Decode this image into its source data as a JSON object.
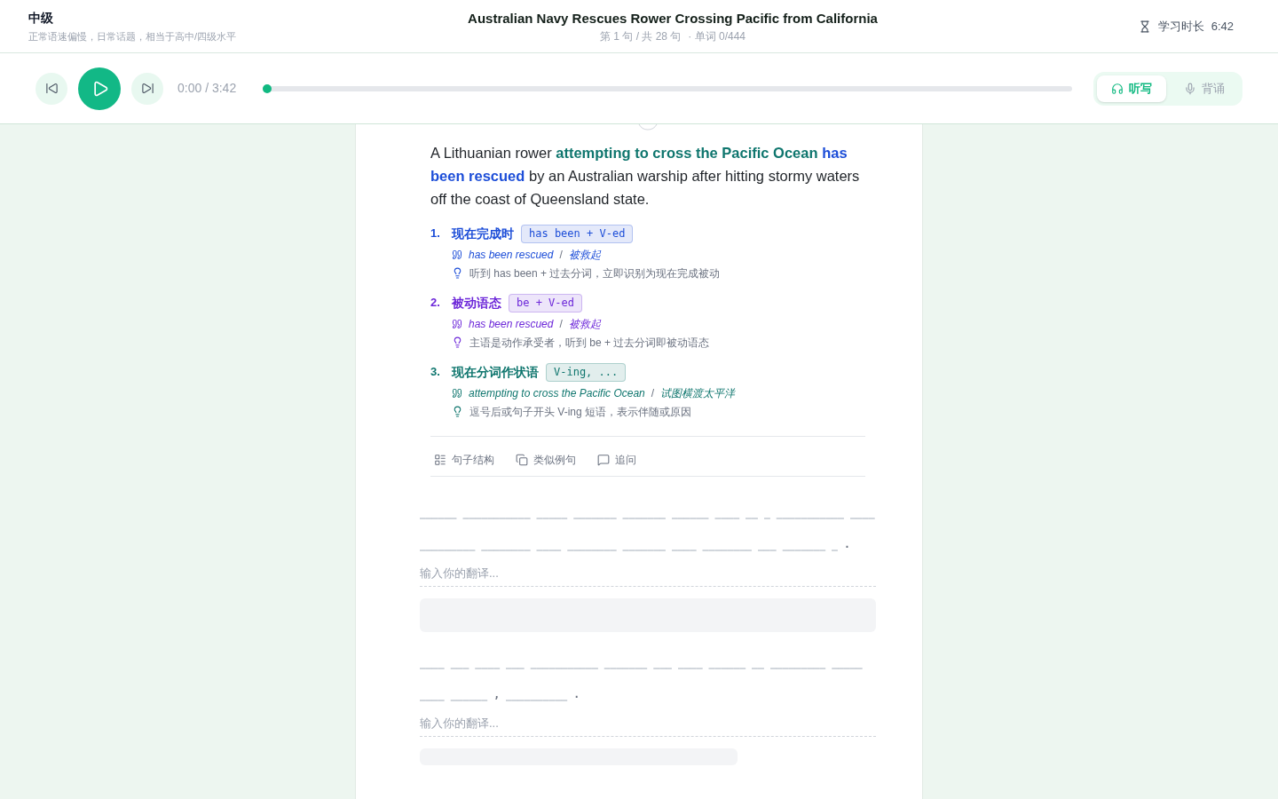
{
  "header": {
    "difficulty": "中级",
    "difficulty_description": "正常语速偏慢，日常话题，相当于高中/四级水平",
    "title": "Australian Navy Rescues Rower Crossing Pacific from California",
    "sentence_counter": "第 1 句 / 共 28 句",
    "word_count": "· 单词 0/444",
    "study_time_label": "学习时长",
    "study_time": "6:42"
  },
  "player": {
    "time": "0:00 / 3:42",
    "progress": {
      "level": 0
    },
    "modes": [
      {
        "label": "听写",
        "kind": "dictation",
        "selected": true
      },
      {
        "label": "背诵",
        "kind": "recite",
        "selected": false
      }
    ]
  },
  "sentence": {
    "segments": [
      {
        "text": "A Lithuanian rower"
      },
      {
        "text": "attempting to cross the Pacific Ocean",
        "color": "#0f766e"
      },
      {
        "text": "has been rescued",
        "color": "#1d4ed8"
      },
      {
        "text": "by an Australian warship after hitting stormy waters off the coast of Queensland state."
      }
    ]
  },
  "grammar_points": [
    {
      "number": "1.",
      "title": "现在完成时",
      "pattern": "has been + V-ed",
      "example": "has been rescued",
      "separator": "/",
      "translation": "被救起",
      "tip": "听到 has been + 过去分词，立即识别为现在完成被动",
      "color": "#1d4ed8"
    },
    {
      "number": "2.",
      "title": "被动语态",
      "pattern": "be + V-ed",
      "example": "has been rescued",
      "separator": "/",
      "translation": "被救起",
      "tip": "主语是动作承受者，听到 be + 过去分词即被动语态",
      "color": "#6d28d9"
    },
    {
      "number": "3.",
      "title": "现在分词作状语",
      "pattern": "V-ing, ...",
      "example": "attempting to cross the Pacific Ocean",
      "separator": "/",
      "translation": "试图横渡太平洋",
      "tip": "逗号后或句子开头 V-ing 短语，表示伴随或原因",
      "color": "#0f766e"
    }
  ],
  "actions": [
    {
      "label": "句子结构",
      "kind": "structure"
    },
    {
      "label": "类似例句",
      "kind": "examples"
    },
    {
      "label": "追问",
      "kind": "ask"
    }
  ],
  "dictation": [
    {
      "tokens": [
        {
          "kind": "blank",
          "text": "______"
        },
        {
          "kind": "blank",
          "text": "___________"
        },
        {
          "kind": "blank",
          "text": "_____"
        },
        {
          "kind": "blank",
          "text": "_______"
        },
        {
          "kind": "blank",
          "text": "_______"
        },
        {
          "kind": "blank",
          "text": "______"
        },
        {
          "kind": "blank",
          "text": "____"
        },
        {
          "kind": "blank",
          "text": "__"
        },
        {
          "kind": "blank",
          "text": "_"
        },
        {
          "kind": "blank",
          "text": "___________"
        },
        {
          "kind": "blank",
          "text": "____"
        },
        {
          "kind": "blank",
          "text": "_________"
        },
        {
          "kind": "blank",
          "text": "________"
        },
        {
          "kind": "blank",
          "text": "____"
        },
        {
          "kind": "blank",
          "text": "________"
        },
        {
          "kind": "blank",
          "text": "_______"
        },
        {
          "kind": "blank",
          "text": "____"
        },
        {
          "kind": "blank",
          "text": "________"
        },
        {
          "kind": "blank",
          "text": "___"
        },
        {
          "kind": "blank",
          "text": "_______"
        },
        {
          "kind": "blank",
          "text": "_"
        },
        {
          "kind": "punctuation",
          "text": "."
        }
      ],
      "translation": {
        "placeholder": "输入你的翻译..."
      }
    },
    {
      "tokens": [
        {
          "kind": "blank",
          "text": "____"
        },
        {
          "kind": "blank",
          "text": "___"
        },
        {
          "kind": "blank",
          "text": "____"
        },
        {
          "kind": "blank",
          "text": "___"
        },
        {
          "kind": "blank",
          "text": "___________"
        },
        {
          "kind": "blank",
          "text": "_______"
        },
        {
          "kind": "blank",
          "text": "___"
        },
        {
          "kind": "blank",
          "text": "____"
        },
        {
          "kind": "blank",
          "text": "______"
        },
        {
          "kind": "blank",
          "text": "__"
        },
        {
          "kind": "blank",
          "text": "_________"
        },
        {
          "kind": "blank",
          "text": "_____"
        },
        {
          "kind": "blank",
          "text": "____"
        },
        {
          "kind": "blank",
          "text": "______"
        },
        {
          "kind": "punctuation",
          "text": ","
        },
        {
          "kind": "blank",
          "text": "__________"
        },
        {
          "kind": "punctuation",
          "text": "."
        }
      ],
      "translation": {
        "placeholder": "输入你的翻译..."
      }
    }
  ]
}
